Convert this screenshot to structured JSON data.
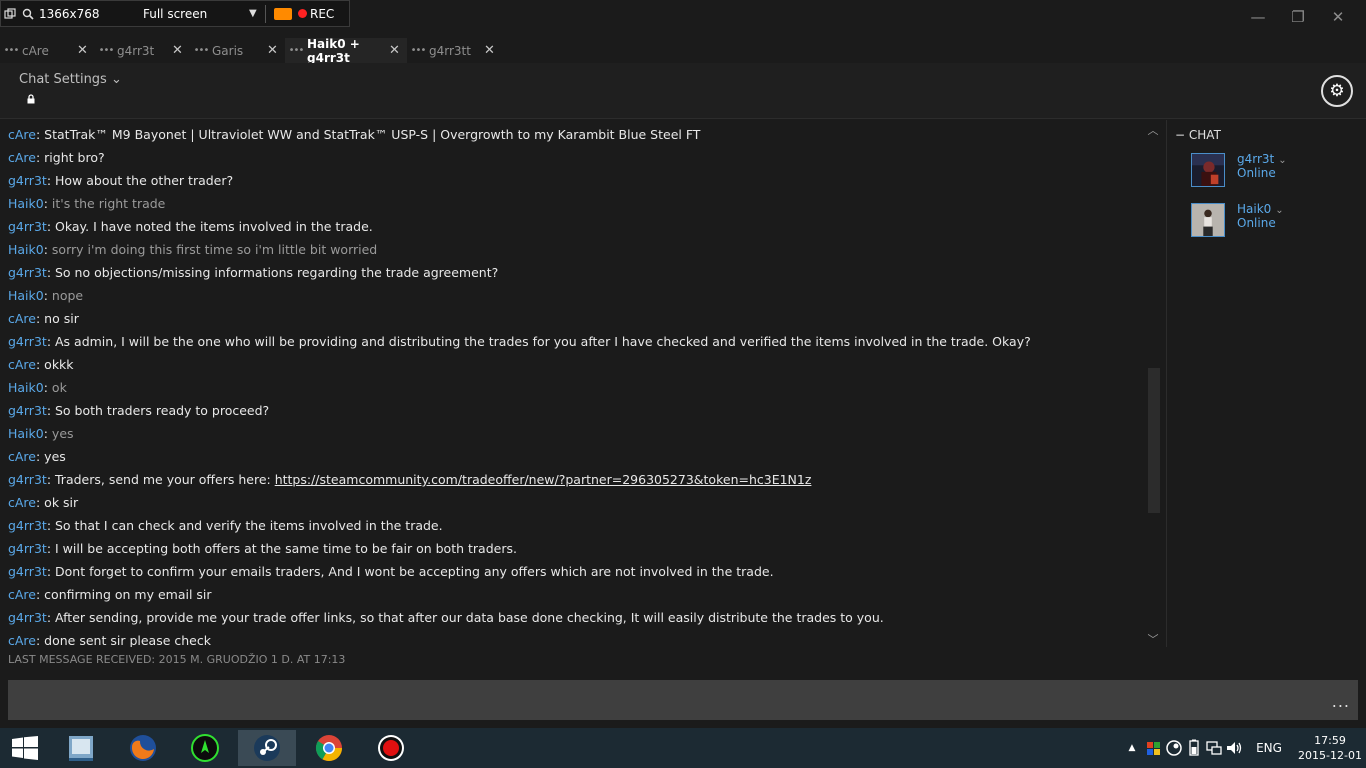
{
  "recorder": {
    "resolution": "1366x768",
    "mode": "Full screen",
    "rec_label": "REC"
  },
  "window": {
    "minimize": "—",
    "restore": "❐",
    "close": "✕"
  },
  "tabs": [
    {
      "label": "cAre",
      "active": false
    },
    {
      "label": "g4rr3t",
      "active": false
    },
    {
      "label": "Garis",
      "active": false
    },
    {
      "label": "Haik0 + g4rr3t",
      "active": true
    },
    {
      "label": "g4rr3tt",
      "active": false
    }
  ],
  "header": {
    "chat_settings": "Chat Settings"
  },
  "messages": [
    {
      "author": "cAre",
      "text": "StatTrak™ M9 Bayonet | Ultraviolet WW and StatTrak™ USP-S | Overgrowth to my Karambit Blue Steel FT",
      "dim": false
    },
    {
      "author": "cAre",
      "text": "right bro?",
      "dim": false
    },
    {
      "author": "g4rr3t",
      "text": "How about the other trader?",
      "dim": false
    },
    {
      "author": "Haik0",
      "text": "it's the right trade",
      "dim": true
    },
    {
      "author": "g4rr3t",
      "text": "Okay. I have noted the items involved in the trade.",
      "dim": false
    },
    {
      "author": "Haik0",
      "text": "sorry i'm doing this first time so i'm little bit worried",
      "dim": true
    },
    {
      "author": "g4rr3t",
      "text": "So no objections/missing informations regarding the trade agreement?",
      "dim": false
    },
    {
      "author": "Haik0",
      "text": "nope",
      "dim": true
    },
    {
      "author": "cAre",
      "text": "no sir",
      "dim": false
    },
    {
      "author": "g4rr3t",
      "text": "As admin, I will be the one who will be providing and distributing the trades for you after I have checked and verified the items involved in the trade. Okay?",
      "dim": false
    },
    {
      "author": "cAre",
      "text": "okkk",
      "dim": false
    },
    {
      "author": "Haik0",
      "text": "ok",
      "dim": true
    },
    {
      "author": "g4rr3t",
      "text": "So both traders ready to proceed?",
      "dim": false
    },
    {
      "author": "Haik0",
      "text": "yes",
      "dim": true
    },
    {
      "author": "cAre",
      "text": "yes",
      "dim": false
    },
    {
      "author": "g4rr3t",
      "text": "Traders, send me your offers here: ",
      "link": "https://steamcommunity.com/tradeoffer/new/?partner=296305273&token=hc3E1N1z",
      "dim": false
    },
    {
      "author": "cAre",
      "text": "ok sir",
      "dim": false
    },
    {
      "author": "g4rr3t",
      "text": "So that I can check and verify the items involved in the trade.",
      "dim": false
    },
    {
      "author": "g4rr3t",
      "text": "I will be accepting both offers at the same time to be fair on both traders.",
      "dim": false
    },
    {
      "author": "g4rr3t",
      "text": "Dont forget to confirm your emails traders, And I wont be accepting any offers which are not involved in the trade.",
      "dim": false
    },
    {
      "author": "cAre",
      "text": "confirming on my email sir",
      "dim": false
    },
    {
      "author": "g4rr3t",
      "text": "After sending, provide me your trade offer links, so that after our data base done checking, It will easily distribute the trades to you.",
      "dim": false
    },
    {
      "author": "cAre",
      "text": "done sent sir please check",
      "dim": false
    }
  ],
  "friends": {
    "heading": "CHAT",
    "items": [
      {
        "name": "g4rr3t",
        "status": "Online"
      },
      {
        "name": "Haik0",
        "status": "Online"
      }
    ]
  },
  "status": {
    "last_message": "LAST MESSAGE RECEIVED: 2015 M. GRUODŽIO 1 D. AT 17:13"
  },
  "input": {
    "more": "..."
  },
  "taskbar": {
    "apps": [
      "windows-start-icon",
      "file-explorer-icon",
      "firefox-icon",
      "razer-icon",
      "steam-icon",
      "chrome-icon",
      "record-icon"
    ],
    "lang": "ENG",
    "time": "17:59",
    "date": "2015-12-01"
  },
  "colors": {
    "author": "#5aa8e8",
    "background": "#1b1b1b",
    "input": "#3f3f3f"
  }
}
